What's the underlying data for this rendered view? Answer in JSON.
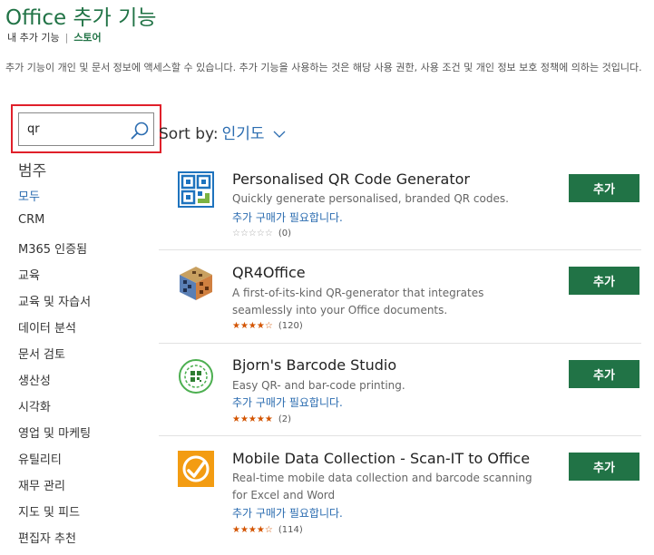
{
  "header": {
    "title": "Office 추가 기능",
    "breadcrumb": {
      "my_addins": "내 추가 기능",
      "separator": "|",
      "store": "스토어"
    }
  },
  "notice": "추가 기능이 개인 및 문서 정보에 액세스할 수 있습니다. 추가 기능을 사용하는 것은 해당 사용 권한, 사용 조건 및 개인 정보 보호 정책에 의하는 것입니다.",
  "search": {
    "value": "qr",
    "placeholder": ""
  },
  "sort": {
    "label": "Sort by:",
    "value": "인기도"
  },
  "categories": {
    "heading": "범주",
    "items": [
      "모두",
      "CRM",
      "M365 인증됨",
      "교육",
      "교육 및 자습서",
      "데이터 분석",
      "문서 검토",
      "생산성",
      "시각화",
      "영업 및 마케팅",
      "유틸리티",
      "재무 관리",
      "지도 및 피드",
      "편집자 추천"
    ],
    "active": "모두"
  },
  "addins": [
    {
      "name": "Personalised QR Code Generator",
      "description": "Quickly generate personalised, branded QR codes.",
      "purchase": "추가 구매가 필요합니다.",
      "stars": "☆☆☆☆☆",
      "rating": 0,
      "count": "(0)",
      "button": "추가",
      "icon": "qr-code-icon"
    },
    {
      "name": "QR4Office",
      "description": "A first-of-its-kind QR-generator that integrates seamlessly into your Office documents.",
      "purchase": "",
      "stars": "★★★★☆",
      "rating": 4,
      "count": "(120)",
      "button": "추가",
      "icon": "qr-cube-icon"
    },
    {
      "name": "Bjorn's Barcode Studio",
      "description": "Easy QR- and bar-code printing.",
      "purchase": "추가 구매가 필요합니다.",
      "stars": "★★★★★",
      "rating": 5,
      "count": "(2)",
      "button": "추가",
      "icon": "barcode-studio-icon"
    },
    {
      "name": "Mobile Data Collection - Scan-IT to Office",
      "description": "Real-time mobile data collection and barcode scanning for Excel and Word",
      "purchase": "추가 구매가 필요합니다.",
      "stars": "★★★★☆",
      "rating": 4,
      "count": "(114)",
      "button": "추가",
      "icon": "scan-it-icon"
    }
  ],
  "colors": {
    "brand_green": "#217346",
    "link_blue": "#2b6cb0",
    "star_orange": "#d35400",
    "highlight_red": "#e0202a"
  }
}
